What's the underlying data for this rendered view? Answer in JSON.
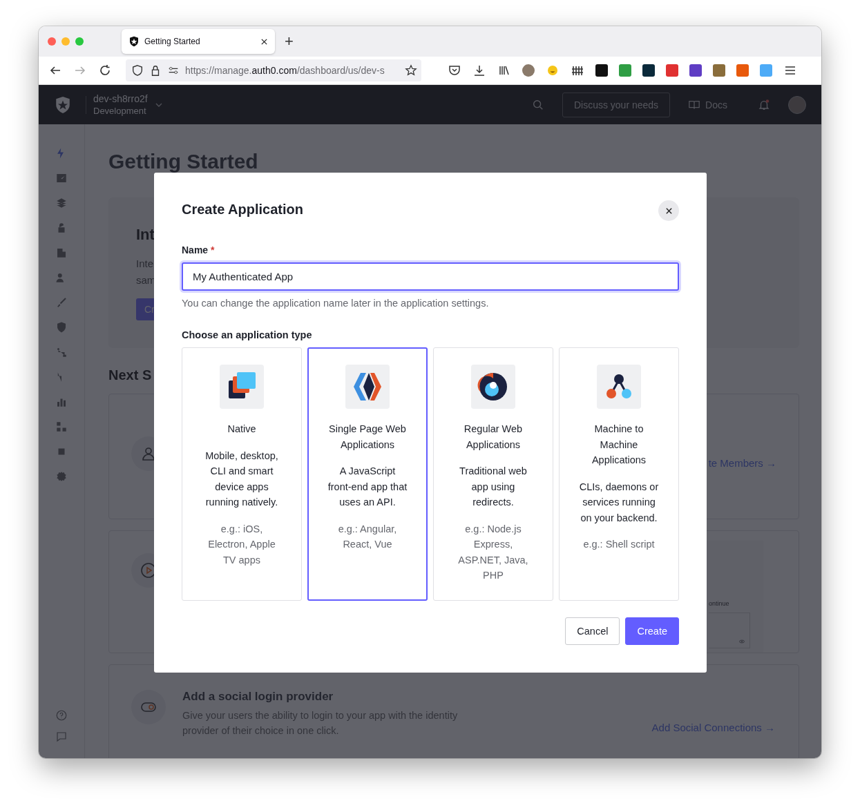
{
  "browser": {
    "tab": {
      "title": "Getting Started",
      "selected": true
    },
    "new_tab": "+",
    "url": {
      "prefix": "https://manage.",
      "domain": "auth0.com",
      "path": "/dashboard/us/dev-s"
    }
  },
  "header": {
    "tenant_name": "dev-sh8rro2f",
    "tenant_env": "Development",
    "cta": "Discuss your needs",
    "docs": "Docs"
  },
  "sidebar": {
    "items": [
      {
        "selected": true
      },
      {
        "selected": false
      },
      {
        "selected": false
      },
      {
        "selected": false
      },
      {
        "selected": false
      },
      {
        "selected": false
      },
      {
        "selected": false
      },
      {
        "selected": false
      },
      {
        "selected": false
      },
      {
        "selected": false
      },
      {
        "selected": false
      },
      {
        "selected": false
      },
      {
        "selected": false
      },
      {
        "selected": false
      }
    ]
  },
  "page": {
    "title": "Getting Started",
    "intro": {
      "title": "Int",
      "lines": [
        "Inte",
        "sam"
      ],
      "button": "Cr"
    },
    "next_steps_title": "Next S",
    "steps": [
      {
        "kind": "members",
        "link": "te Members →"
      },
      {
        "kind": "login",
        "preview_text": "ontinue"
      },
      {
        "kind": "social",
        "title": "Add a social login provider",
        "description": "Give your users the ability to login to your app with the identity provider of their choice in one click.",
        "link": "Add Social Connections →"
      }
    ]
  },
  "modal": {
    "title": "Create Application",
    "name_label": "Name",
    "required_mark": "*",
    "name_value": "My Authenticated App",
    "hint": "You can change the application name later in the application settings.",
    "type_label": "Choose an application type",
    "types": [
      {
        "kind": "native",
        "name": "Native",
        "description": "Mobile, desktop, CLI and smart device apps running natively.",
        "examples": "e.g.: iOS, Electron, Apple TV apps",
        "selected": false
      },
      {
        "kind": "spa",
        "name": "Single Page Web Applications",
        "description": "A JavaScript front-end app that uses an API.",
        "examples": "e.g.: Angular, React, Vue",
        "selected": true
      },
      {
        "kind": "regular",
        "name": "Regular Web Applications",
        "description": "Traditional web app using redirects.",
        "examples": "e.g.: Node.js Express, ASP.NET, Java, PHP",
        "selected": false
      },
      {
        "kind": "m2m",
        "name": "Machine to Machine Applications",
        "description": "CLIs, daemons or services running on your backend.",
        "examples": "e.g.: Shell script",
        "selected": false
      }
    ],
    "cancel": "Cancel",
    "create": "Create"
  }
}
